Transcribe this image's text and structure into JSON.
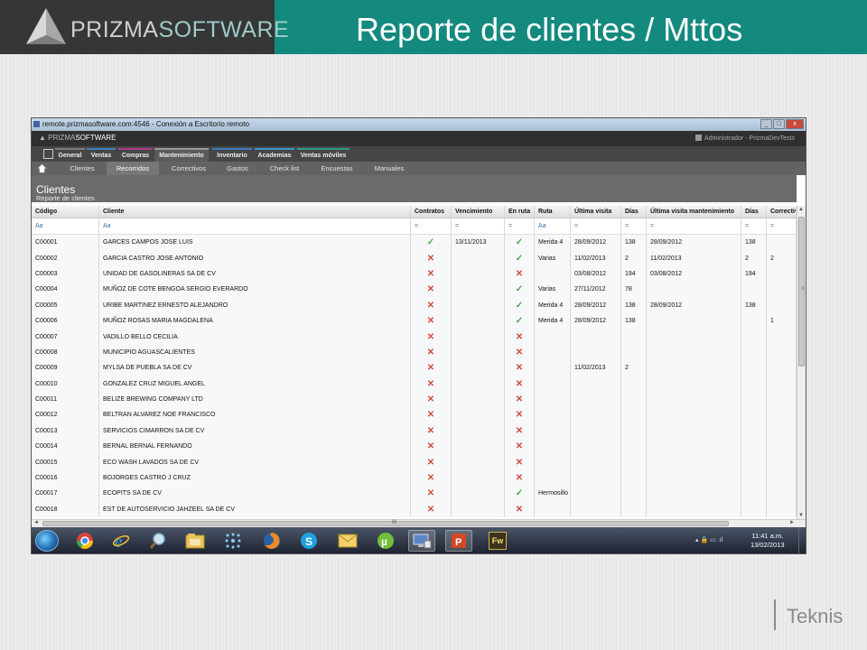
{
  "slide": {
    "title": "Reporte de clientes / Mttos",
    "logo_part1": "PRIZMA",
    "logo_part2": "SOFTWARE",
    "footer_brand": "Teknis"
  },
  "window": {
    "title": "remote.prizmasoftware.com:4546 - Conexión a Escritorio remoto",
    "min": "_",
    "max": "□",
    "close": "x"
  },
  "app": {
    "logo_part1": "PRIZMA",
    "logo_part2": "SOFTWARE",
    "user": "Administrador - PrizmaDevTests"
  },
  "menu1": [
    "General",
    "Ventas",
    "Compras",
    "Mantenimiento",
    "Inventario",
    "Academias",
    "Ventas móviles"
  ],
  "menu2": [
    "Clientes",
    "Recorridos",
    "Correctivos",
    "Gastos",
    "Check list",
    "Encuestas",
    "Manuales"
  ],
  "colors": {
    "menu_general": "#7c7c7c",
    "menu_ventas": "#3b7fc0",
    "menu_compras": "#b03a86",
    "menu_mantenimiento": "#5b5b5b",
    "menu_inventario": "#3d79c2",
    "menu_academias": "#3d96c7",
    "menu_ventas_moviles": "#2e9a88",
    "ok": "#4aa74a",
    "no": "#d34b3b"
  },
  "section": {
    "title": "Clientes",
    "subtitle": "Reporte de clientes"
  },
  "table": {
    "headers": [
      "Código",
      "Cliente",
      "Contratos",
      "Vencimiento",
      "En ruta",
      "Ruta",
      "Última visita",
      "Días",
      "Última visita mantenimiento",
      "Días",
      "Correctiv"
    ],
    "filters": [
      "Aa",
      "Aa",
      "=",
      "=",
      "=",
      "Aa",
      "=",
      "=",
      "=",
      "=",
      "="
    ],
    "rows": [
      [
        "C00001",
        "GARCES CAMPOS JOSE LUIS",
        "ok",
        "13/11/2013",
        "ok",
        "Merida 4",
        "28/09/2012",
        "138",
        "28/09/2012",
        "138",
        ""
      ],
      [
        "C00002",
        "GARCIA CASTRO JOSE ANTONIO",
        "no",
        "",
        "ok",
        "Varias",
        "11/02/2013",
        "2",
        "11/02/2013",
        "2",
        "2"
      ],
      [
        "C00003",
        "UNIDAD DE GASOLINERAS SA DE CV",
        "no",
        "",
        "no",
        "",
        "03/08/2012",
        "194",
        "03/08/2012",
        "194",
        ""
      ],
      [
        "C00004",
        "MUÑOZ DE COTE BENGOA SERGIO EVERARDO",
        "no",
        "",
        "ok",
        "Varias",
        "27/11/2012",
        "78",
        "",
        "",
        ""
      ],
      [
        "C00005",
        "URIBE MARTINEZ ERNESTO ALEJANDRO",
        "no",
        "",
        "ok",
        "Merida 4",
        "28/09/2012",
        "138",
        "28/09/2012",
        "138",
        ""
      ],
      [
        "C00006",
        "MUÑOZ ROSAS MARIA MAGDALENA",
        "no",
        "",
        "ok",
        "Merida 4",
        "28/09/2012",
        "138",
        "",
        "",
        "1"
      ],
      [
        "C00007",
        "VADILLO BELLO CECILIA",
        "no",
        "",
        "no",
        "",
        "",
        "",
        "",
        "",
        ""
      ],
      [
        "C00008",
        "MUNICIPIO AGUASCALIENTES",
        "no",
        "",
        "no",
        "",
        "",
        "",
        "",
        "",
        ""
      ],
      [
        "C00009",
        "MYLSA DE PUEBLA SA DE CV",
        "no",
        "",
        "no",
        "",
        "11/02/2013",
        "2",
        "",
        "",
        ""
      ],
      [
        "C00010",
        "GONZALEZ CRUZ MIGUEL ANGEL",
        "no",
        "",
        "no",
        "",
        "",
        "",
        "",
        "",
        ""
      ],
      [
        "C00011",
        "BELIZE BREWING COMPANY LTD",
        "no",
        "",
        "no",
        "",
        "",
        "",
        "",
        "",
        ""
      ],
      [
        "C00012",
        "BELTRAN ALVAREZ NOE FRANCISCO",
        "no",
        "",
        "no",
        "",
        "",
        "",
        "",
        "",
        ""
      ],
      [
        "C00013",
        "SERVICIOS CIMARRON SA DE CV",
        "no",
        "",
        "no",
        "",
        "",
        "",
        "",
        "",
        ""
      ],
      [
        "C00014",
        "BERNAL BERNAL FERNANDO",
        "no",
        "",
        "no",
        "",
        "",
        "",
        "",
        "",
        ""
      ],
      [
        "C00015",
        "ECO WASH LAVADOS SA DE CV",
        "no",
        "",
        "no",
        "",
        "",
        "",
        "",
        "",
        ""
      ],
      [
        "C00016",
        "BOJORGES CASTRO J CRUZ",
        "no",
        "",
        "no",
        "",
        "",
        "",
        "",
        "",
        ""
      ],
      [
        "C00017",
        "ECOPITS SA DE CV",
        "no",
        "",
        "ok",
        "Hermosillo",
        "",
        "",
        "",
        "",
        ""
      ],
      [
        "C00018",
        "EST DE AUTOSERVICIO JAHZEEL SA DE CV",
        "no",
        "",
        "no",
        "",
        "",
        "",
        "",
        "",
        ""
      ]
    ]
  },
  "scroll": {
    "vgrip": "≡",
    "hgrip": "III",
    "up": "▲",
    "down": "▼",
    "left": "◄",
    "right": "►"
  },
  "taskbar": {
    "apps": [
      "chrome-icon",
      "ie-icon",
      "search-app-icon",
      "explorer-icon",
      "dots-app-icon",
      "firefox-icon",
      "skype-icon",
      "outlook-icon",
      "utorrent-icon",
      "remote-desktop-icon",
      "powerpoint-icon",
      "fireworks-icon"
    ],
    "fw_label": "Fw",
    "tray": "▴ 🔒 ▭ .ıl",
    "time": "11:41 a.m.",
    "date": "13/02/2013"
  }
}
